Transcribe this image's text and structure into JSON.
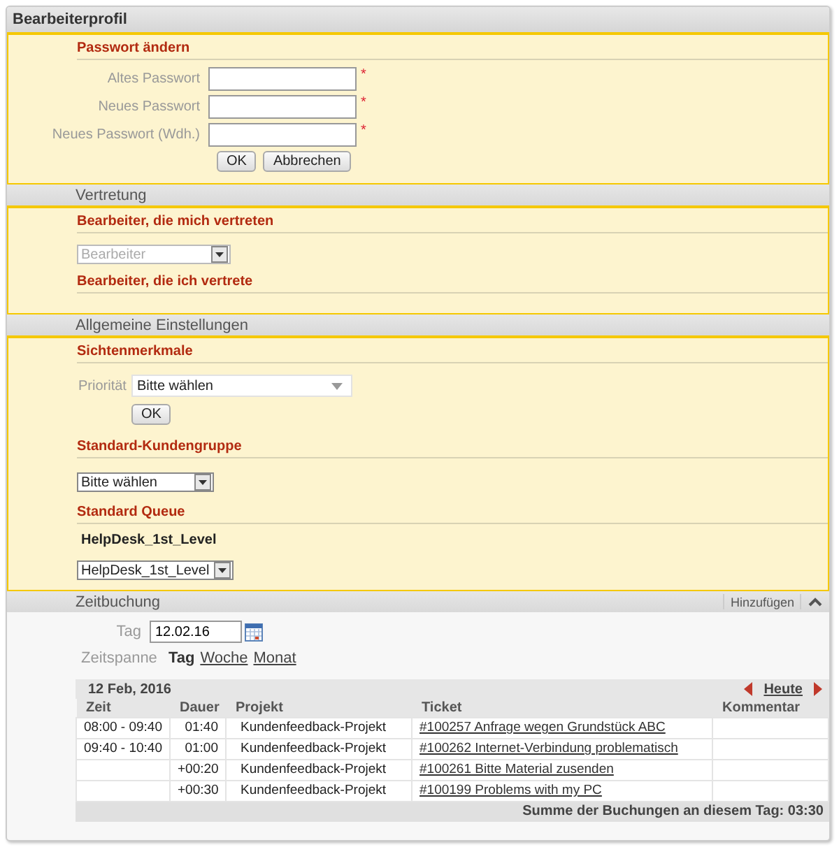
{
  "panel": {
    "title": "Bearbeiterprofil"
  },
  "password": {
    "heading": "Passwort ändern",
    "fields": [
      {
        "label": "Altes Passwort",
        "required_mark": "*"
      },
      {
        "label": "Neues Passwort",
        "required_mark": "*"
      },
      {
        "label": "Neues Passwort (Wdh.)",
        "required_mark": "*"
      }
    ],
    "buttons": [
      "OK",
      "Abbrechen"
    ]
  },
  "substitution": {
    "title": "Vertretung",
    "groups": [
      {
        "heading": "Bearbeiter, die mich vertreten",
        "select": {
          "placeholder": "Bearbeiter"
        }
      },
      {
        "heading": "Bearbeiter, die ich vertrete"
      }
    ]
  },
  "general": {
    "title": "Allgemeine Einstellungen",
    "view": {
      "heading": "Sichtenmerkmale",
      "label": "Priorität",
      "value": "Bitte wählen",
      "button": "OK"
    },
    "customer_group": {
      "heading": "Standard-Kundengruppe",
      "value": "Bitte wählen"
    },
    "queue": {
      "heading": "Standard Queue",
      "current": "HelpDesk_1st_Level",
      "value": "HelpDesk_1st_Level"
    }
  },
  "time": {
    "title": "Zeitbuchung",
    "action": "Hinzufügen",
    "expanded": true,
    "day_label": "Tag",
    "day_value": "12.02.16",
    "span_label": "Zeitspanne",
    "spans": [
      {
        "label": "Tag",
        "selected": true
      },
      {
        "label": "Woche",
        "selected": false
      },
      {
        "label": "Monat",
        "selected": false
      }
    ],
    "table": {
      "date": "12 Feb, 2016",
      "nav_label": "Heute",
      "columns": [
        "Zeit",
        "Dauer",
        "Projekt",
        "Ticket",
        "Kommentar"
      ],
      "rows": [
        {
          "time": "08:00 - 09:40",
          "duration": "01:40",
          "project": "Kundenfeedback-Projekt",
          "ticket": "#100257 Anfrage wegen Grundstück ABC"
        },
        {
          "time": "09:40 - 10:40",
          "duration": "01:00",
          "project": "Kundenfeedback-Projekt",
          "ticket": "#100262 Internet-Verbindung problematisch"
        },
        {
          "duration": "+00:20",
          "project": "Kundenfeedback-Projekt",
          "ticket": "#100261 Bitte Material zusenden"
        },
        {
          "duration": "+00:30",
          "project": "Kundenfeedback-Projekt",
          "ticket": "#100199 Problems with my PC"
        }
      ],
      "footer": "Summe der Buchungen an diesem Tag: 03:30"
    }
  }
}
